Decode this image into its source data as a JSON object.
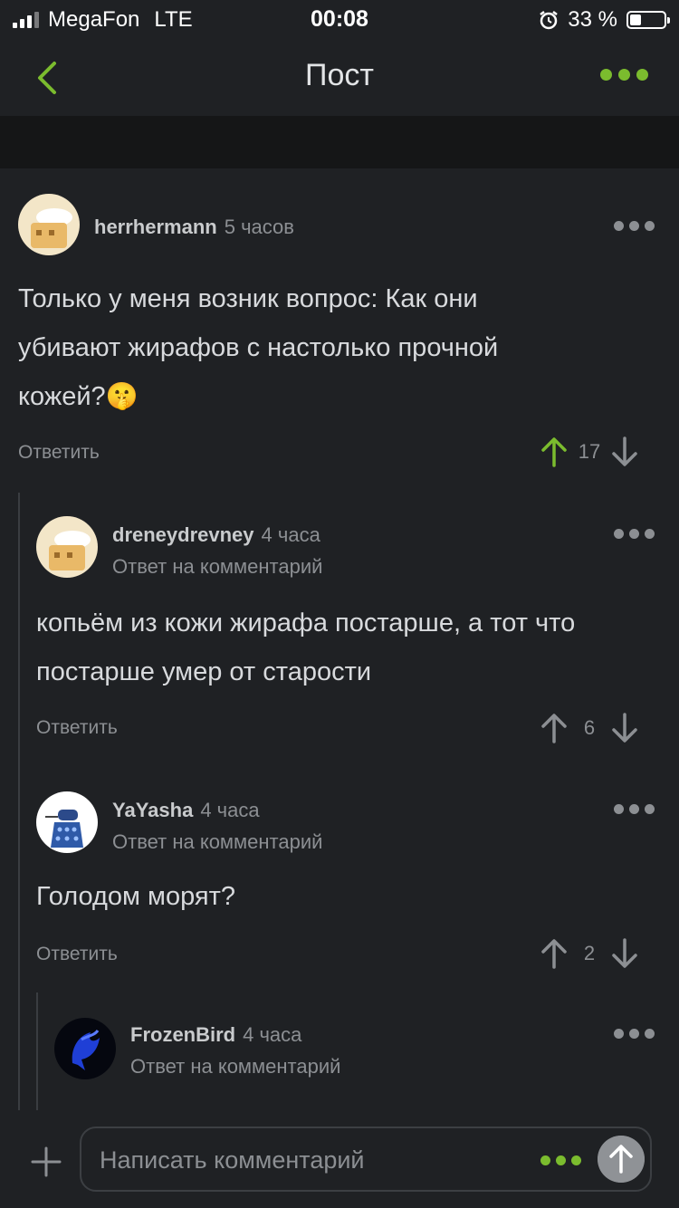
{
  "status_bar": {
    "carrier": "MegaFon",
    "network": "LTE",
    "time": "00:08",
    "battery": "33 %",
    "battery_level": 0.33
  },
  "nav": {
    "title": "Пост",
    "back_icon": "chevron-left-icon",
    "more_icon": "more-dots-icon",
    "accent": "#7bbc2e"
  },
  "comments": [
    {
      "username": "herrhermann",
      "time": "5 часов",
      "reply_to": "",
      "text_lines": [
        "Только у меня возник вопрос: Как они",
        "убивают жирафов с настолько прочной",
        "кожей?🤫"
      ],
      "reply_label": "Ответить",
      "votes": "17",
      "upvoted": true
    },
    {
      "username": "dreneydrevney",
      "time": "4 часа",
      "reply_to": "Ответ на комментарий",
      "text_lines": [
        "копьём из кожи жирафа постарше, а тот что",
        "постарше умер от старости"
      ],
      "reply_label": "Ответить",
      "votes": "6",
      "upvoted": false
    },
    {
      "username": "YaYasha",
      "time": "4 часа",
      "reply_to": "Ответ на комментарий",
      "text_lines": [
        "Голодом морят?"
      ],
      "reply_label": "Ответить",
      "votes": "2",
      "upvoted": false
    },
    {
      "username": "FrozenBird",
      "time": "4 часа",
      "reply_to": "Ответ на комментарий"
    }
  ],
  "composer": {
    "placeholder": "Написать комментарий",
    "plus_icon": "plus-icon",
    "send_icon": "arrow-up-icon"
  }
}
